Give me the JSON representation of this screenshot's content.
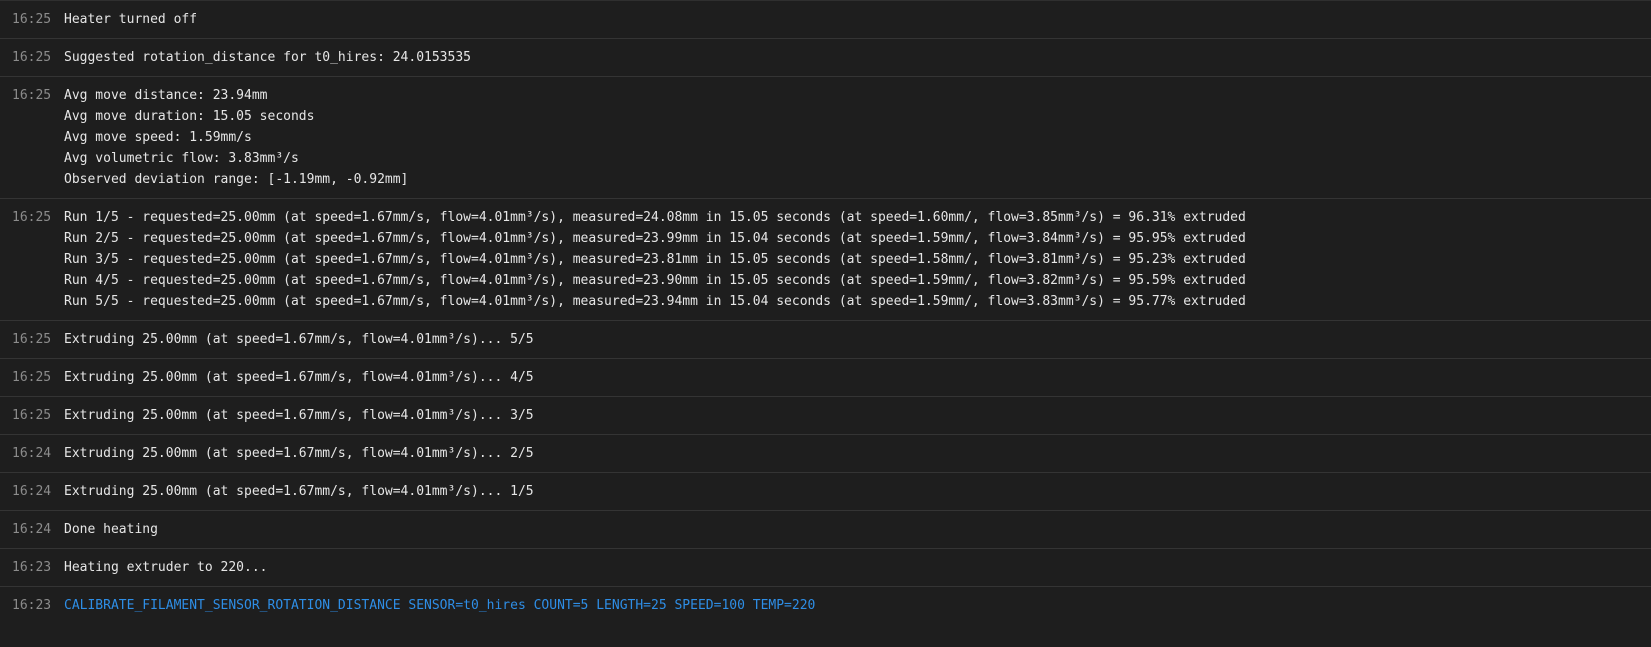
{
  "console": {
    "entries": [
      {
        "time": "16:25",
        "kind": "response",
        "lines": [
          "Heater turned off"
        ]
      },
      {
        "time": "16:25",
        "kind": "response",
        "lines": [
          "Suggested rotation_distance for t0_hires: 24.0153535"
        ]
      },
      {
        "time": "16:25",
        "kind": "response",
        "lines": [
          "Avg move distance: 23.94mm",
          "Avg move duration: 15.05 seconds",
          "Avg move speed: 1.59mm/s",
          "Avg volumetric flow: 3.83mm³/s",
          "Observed deviation range: [-1.19mm, -0.92mm]"
        ]
      },
      {
        "time": "16:25",
        "kind": "response",
        "lines": [
          "Run 1/5 - requested=25.00mm (at speed=1.67mm/s, flow=4.01mm³/s), measured=24.08mm in 15.05 seconds (at speed=1.60mm/, flow=3.85mm³/s) = 96.31% extruded",
          "Run 2/5 - requested=25.00mm (at speed=1.67mm/s, flow=4.01mm³/s), measured=23.99mm in 15.04 seconds (at speed=1.59mm/, flow=3.84mm³/s) = 95.95% extruded",
          "Run 3/5 - requested=25.00mm (at speed=1.67mm/s, flow=4.01mm³/s), measured=23.81mm in 15.05 seconds (at speed=1.58mm/, flow=3.81mm³/s) = 95.23% extruded",
          "Run 4/5 - requested=25.00mm (at speed=1.67mm/s, flow=4.01mm³/s), measured=23.90mm in 15.05 seconds (at speed=1.59mm/, flow=3.82mm³/s) = 95.59% extruded",
          "Run 5/5 - requested=25.00mm (at speed=1.67mm/s, flow=4.01mm³/s), measured=23.94mm in 15.04 seconds (at speed=1.59mm/, flow=3.83mm³/s) = 95.77% extruded"
        ]
      },
      {
        "time": "16:25",
        "kind": "response",
        "lines": [
          "Extruding 25.00mm (at speed=1.67mm/s, flow=4.01mm³/s)... 5/5"
        ]
      },
      {
        "time": "16:25",
        "kind": "response",
        "lines": [
          "Extruding 25.00mm (at speed=1.67mm/s, flow=4.01mm³/s)... 4/5"
        ]
      },
      {
        "time": "16:25",
        "kind": "response",
        "lines": [
          "Extruding 25.00mm (at speed=1.67mm/s, flow=4.01mm³/s)... 3/5"
        ]
      },
      {
        "time": "16:24",
        "kind": "response",
        "lines": [
          "Extruding 25.00mm (at speed=1.67mm/s, flow=4.01mm³/s)... 2/5"
        ]
      },
      {
        "time": "16:24",
        "kind": "response",
        "lines": [
          "Extruding 25.00mm (at speed=1.67mm/s, flow=4.01mm³/s)... 1/5"
        ]
      },
      {
        "time": "16:24",
        "kind": "response",
        "lines": [
          "Done heating"
        ]
      },
      {
        "time": "16:23",
        "kind": "response",
        "lines": [
          "Heating extruder to 220..."
        ]
      },
      {
        "time": "16:23",
        "kind": "command",
        "lines": [
          "CALIBRATE_FILAMENT_SENSOR_ROTATION_DISTANCE SENSOR=t0_hires COUNT=5 LENGTH=25 SPEED=100 TEMP=220"
        ]
      }
    ]
  },
  "colors": {
    "background": "#1e1e1e",
    "text": "#e6e6e6",
    "timestamp": "#8c8c8c",
    "divider": "#343434",
    "command": "#2e8ee6"
  }
}
